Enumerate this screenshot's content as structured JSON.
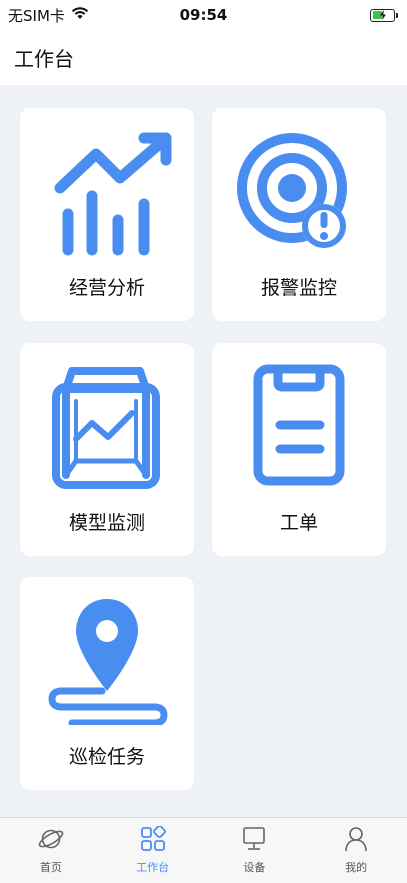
{
  "status_bar": {
    "carrier": "无SIM卡",
    "time": "09:54"
  },
  "header": {
    "title": "工作台"
  },
  "cards": [
    {
      "label": "经营分析",
      "icon": "chart-trend-icon"
    },
    {
      "label": "报警监控",
      "icon": "alarm-radar-icon"
    },
    {
      "label": "模型监测",
      "icon": "model-box-icon"
    },
    {
      "label": "工单",
      "icon": "clipboard-icon"
    },
    {
      "label": "巡检任务",
      "icon": "route-pin-icon"
    }
  ],
  "tabbar": [
    {
      "label": "首页",
      "icon": "planet-icon",
      "active": false
    },
    {
      "label": "工作台",
      "icon": "grid-icon",
      "active": true
    },
    {
      "label": "设备",
      "icon": "monitor-icon",
      "active": false
    },
    {
      "label": "我的",
      "icon": "user-icon",
      "active": false
    }
  ],
  "colors": {
    "accent": "#4a8df0",
    "background": "#eef1f5"
  }
}
